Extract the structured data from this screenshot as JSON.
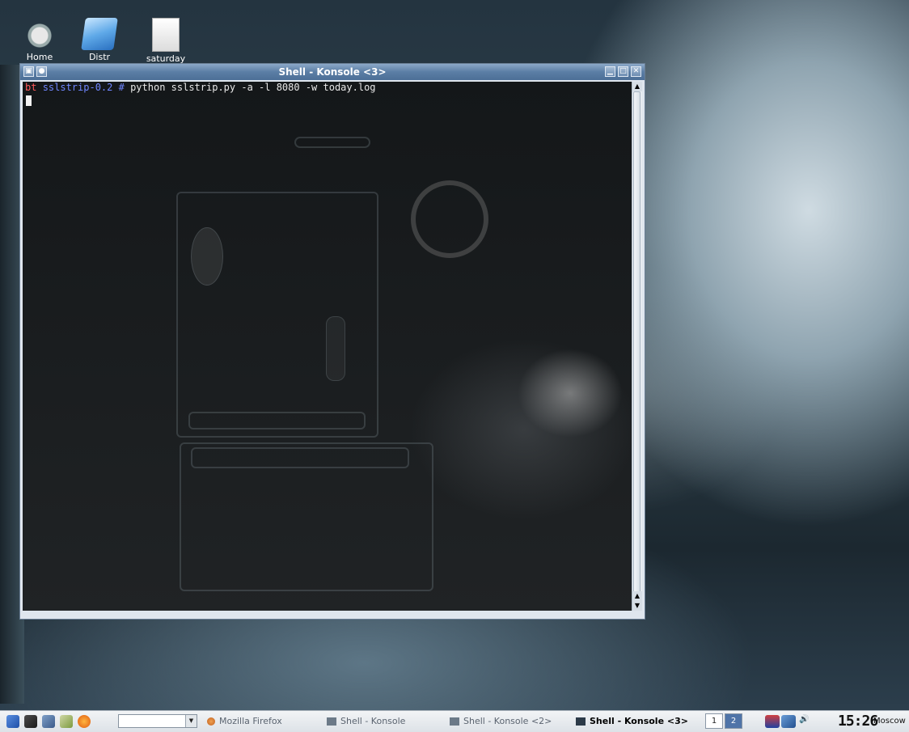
{
  "desktop": {
    "icons": [
      {
        "label": "Home",
        "icon": "home-icon"
      },
      {
        "label": "Distr",
        "icon": "folder-icon"
      },
      {
        "label": "saturday",
        "icon": "document-icon"
      }
    ]
  },
  "window": {
    "title": "Shell - Konsole <3>",
    "terminal": {
      "prompt_host": "bt",
      "prompt_dir": "sslstrip-0.2 #",
      "command": "python sslstrip.py -a -l 8080 -w today.log"
    }
  },
  "taskbar": {
    "tasks": [
      {
        "label": "Mozilla Firefox",
        "icon": "firefox-icon",
        "active": false
      },
      {
        "label": "Shell - Konsole",
        "icon": "konsole-icon",
        "active": false
      },
      {
        "label": "Shell - Konsole <2>",
        "icon": "konsole-icon",
        "active": false
      },
      {
        "label": "Shell - Konsole <3>",
        "icon": "konsole-icon",
        "active": true
      }
    ],
    "pager": [
      "1",
      "2"
    ],
    "clock": "15:26",
    "timezone": "Moscow"
  },
  "colors": {
    "prompt_host": "#ff5a5a",
    "prompt_dir": "#6f86ff",
    "titlebar": "#5b7ea5"
  }
}
